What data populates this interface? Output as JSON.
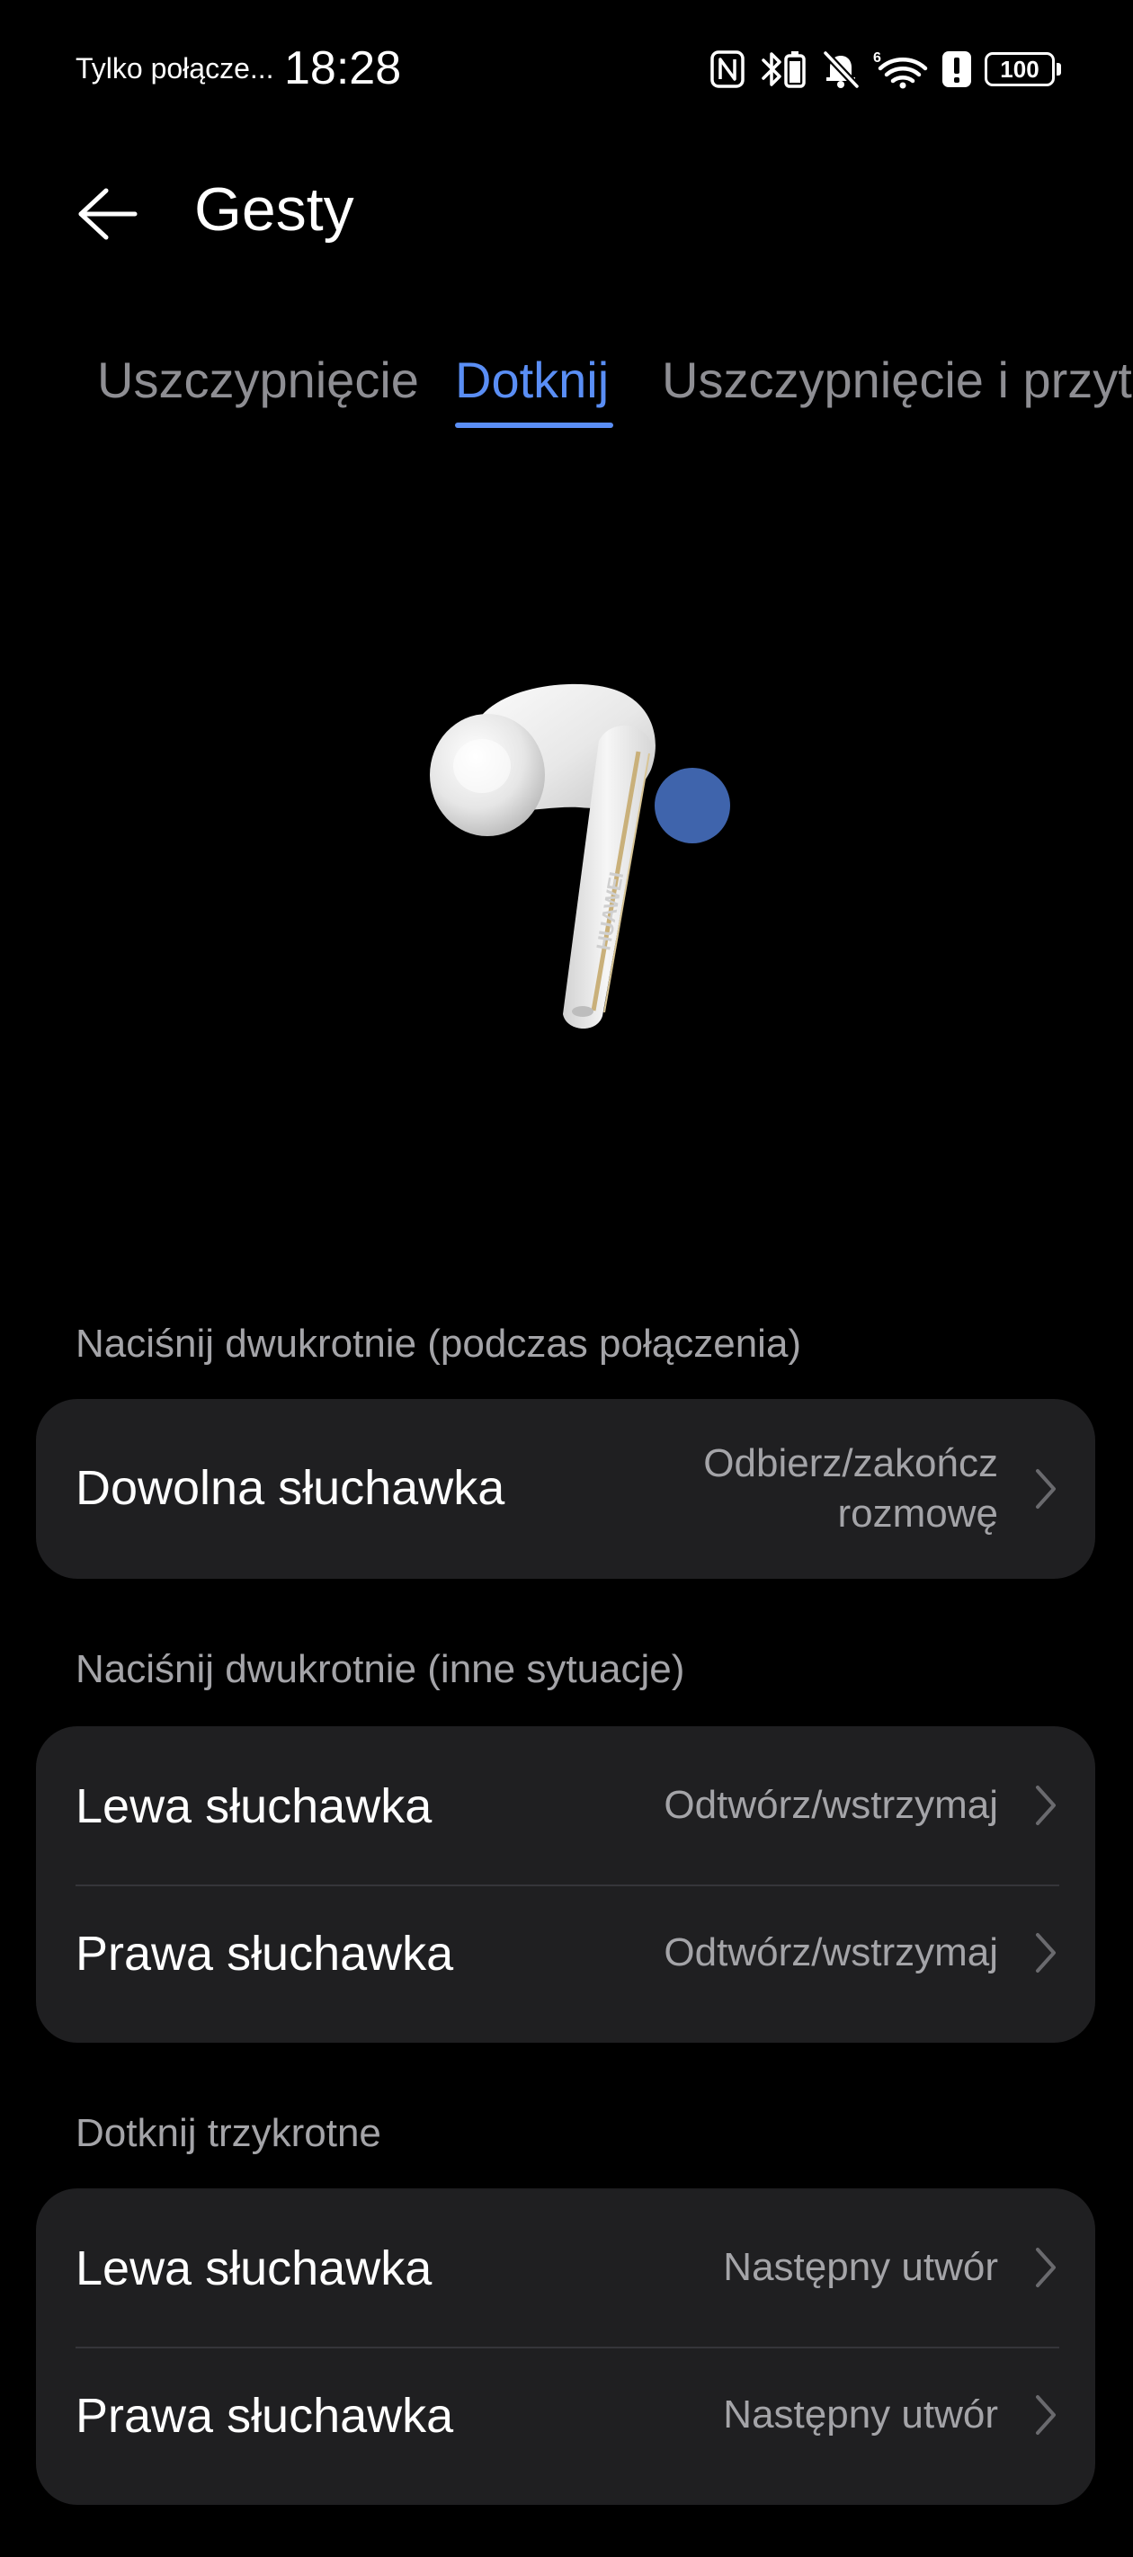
{
  "status_bar": {
    "carrier": "Tylko połącze...",
    "time": "18:28",
    "icons": [
      "nfc-icon",
      "bluetooth-battery-icon",
      "silent-bell-icon",
      "wifi-6-icon",
      "alert-icon",
      "battery-icon"
    ],
    "battery_level": "100"
  },
  "header": {
    "title": "Gesty",
    "back_icon": "back-arrow-icon"
  },
  "tabs": [
    {
      "label": "Uszczypnięcie",
      "active": false
    },
    {
      "label": "Dotknij",
      "active": true
    },
    {
      "label": "Uszczypnięcie i przyt",
      "active": false
    }
  ],
  "accent_color": "#5a8ef5",
  "illustration": {
    "brand_text": "HUAWEI"
  },
  "sections": [
    {
      "header": "Naciśnij dwukrotnie (podczas połączenia)",
      "rows": [
        {
          "label": "Dowolna słuchawka",
          "value_line1": "Odbierz/zakończ",
          "value_line2": "rozmowę"
        }
      ]
    },
    {
      "header": "Naciśnij dwukrotnie (inne sytuacje)",
      "rows": [
        {
          "label": "Lewa słuchawka",
          "value": "Odtwórz/wstrzymaj"
        },
        {
          "label": "Prawa słuchawka",
          "value": "Odtwórz/wstrzymaj"
        }
      ]
    },
    {
      "header": "Dotknij trzykrotne",
      "rows": [
        {
          "label": "Lewa słuchawka",
          "value": "Następny utwór"
        },
        {
          "label": "Prawa słuchawka",
          "value": "Następny utwór"
        }
      ]
    }
  ]
}
